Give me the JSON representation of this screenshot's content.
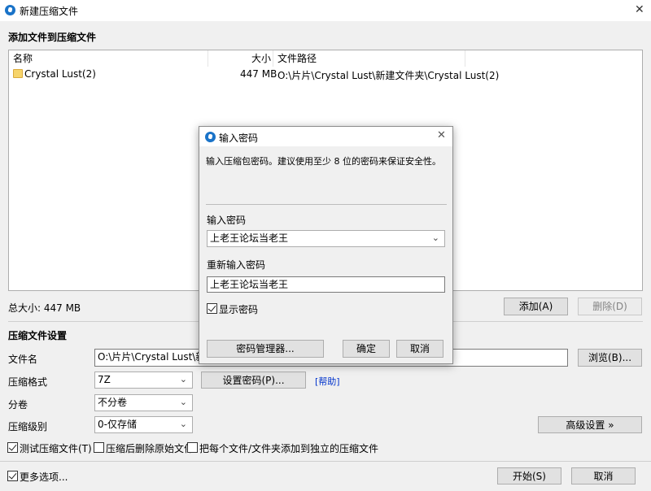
{
  "window": {
    "title": "新建压缩文件",
    "close_glyph": "✕"
  },
  "section_add": {
    "heading": "添加文件到压缩文件"
  },
  "file_list": {
    "columns": [
      "名称",
      "大小",
      "文件路径"
    ],
    "rows": [
      {
        "name": "Crystal Lust(2)",
        "size": "447 MB",
        "path": "O:\\片片\\Crystal Lust\\新建文件夹\\Crystal Lust(2)"
      }
    ]
  },
  "total_size": "总大小: 447 MB",
  "buttons": {
    "add": "添加(A)",
    "remove": "删除(D)",
    "browse": "浏览(B)...",
    "set_password": "设置密码(P)...",
    "advanced": "高级设置 »",
    "start": "开始(S)",
    "cancel": "取消"
  },
  "help_link": "[帮助]",
  "settings": {
    "heading": "压缩文件设置",
    "filename_label": "文件名",
    "filename_value": "O:\\片片\\Crystal Lust\\新建文",
    "format_label": "压缩格式",
    "format_value": "7Z",
    "split_label": "分卷",
    "split_value": "不分卷",
    "level_label": "压缩级别",
    "level_value": "0-仅存储"
  },
  "options": {
    "test_archive": {
      "label": "测试压缩文件(T)",
      "checked": true
    },
    "delete_after": {
      "label": "压缩后删除原始文件",
      "checked": false
    },
    "separate": {
      "label": "把每个文件/文件夹添加到独立的压缩文件",
      "checked": false
    },
    "more": {
      "label": "更多选项...",
      "checked": true
    }
  },
  "dialog": {
    "title": "输入密码",
    "close_glyph": "✕",
    "hint": "输入压缩包密码。建议使用至少 8 位的密码来保证安全性。",
    "password_label": "输入密码",
    "password_value": "上老王论坛当老王",
    "reenter_label": "重新输入密码",
    "reenter_value": "上老王论坛当老王",
    "show_password": {
      "label": "显示密码",
      "checked": true
    },
    "manager_button": "密码管理器...",
    "ok_button": "确定",
    "cancel_button": "取消"
  }
}
